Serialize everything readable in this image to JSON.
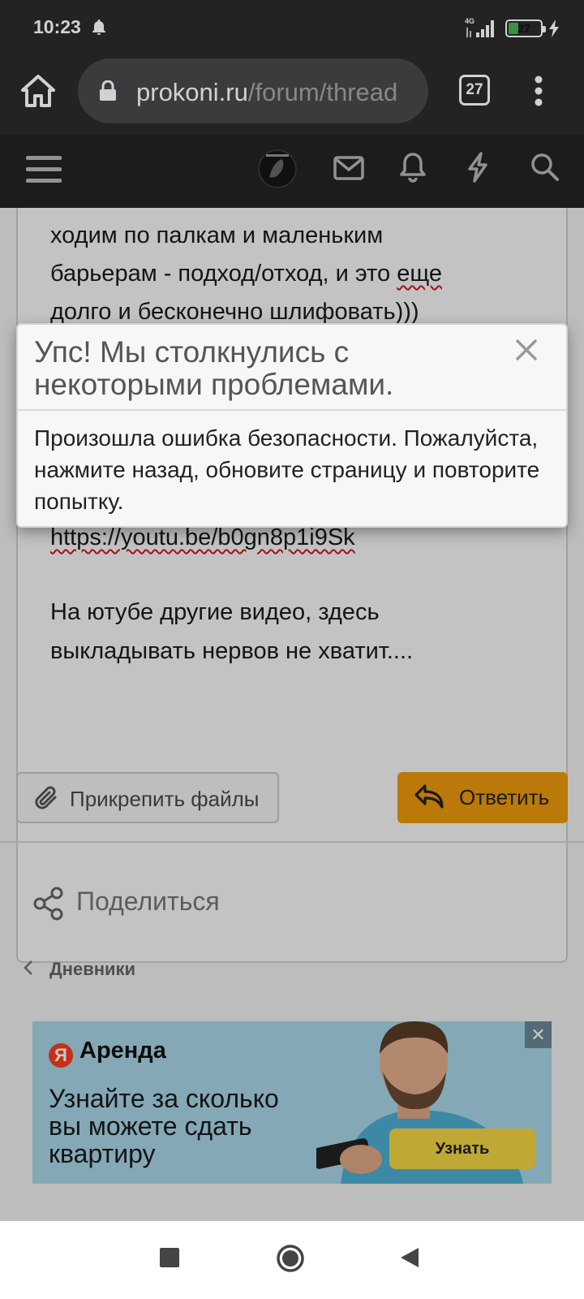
{
  "status_bar": {
    "time": "10:23",
    "network": "4G",
    "battery": "27"
  },
  "browser": {
    "url_domain": "prokoni.ru",
    "url_path": "/forum/thread",
    "tab_count": "27"
  },
  "post": {
    "lines": [
      "ходим по палкам и маленьким",
      "барьерам - подход/отход, и это ",
      "долго и бесконечно шлифовать)))"
    ],
    "squiggle_word": "еще",
    "link": "https://youtu.be/b0gn8p1i9Sk",
    "text2_line1": "На ютубе другие видео, здесь",
    "text2_line2": "выкладывать нервов не хватит...."
  },
  "actions": {
    "attach_label": "Прикрепить файлы",
    "reply_label": "Ответить"
  },
  "share_label": "Поделиться",
  "breadcrumb_label": "Дневники",
  "ad": {
    "brand": "Аренда",
    "brand_badge": "Я",
    "text_line1": "Узнайте за сколько",
    "text_line2": "вы можете сдать",
    "text_line3": "квартиру",
    "cta": "Узнать",
    "close": "✕"
  },
  "dialog": {
    "title": "Упс! Мы столкнулись с некоторыми проблемами.",
    "body": "Произошла ошибка безопасности. Пожалуйста, нажмите назад, обновите страницу и повторите попытку."
  },
  "colors": {
    "accent": "#ef9c0b",
    "toolbar": "#2b2b2d",
    "site_bar": "#242527"
  }
}
